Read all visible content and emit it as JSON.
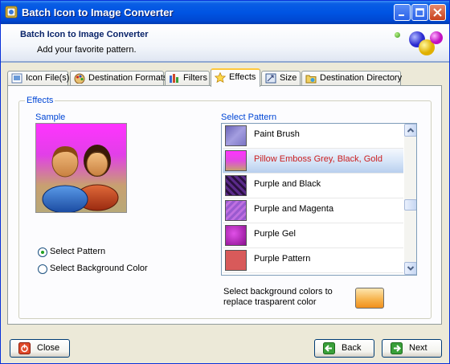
{
  "window": {
    "title": "Batch Icon to Image Converter",
    "controls": [
      "minimize-icon",
      "maximize-icon",
      "close-icon"
    ]
  },
  "header": {
    "title": "Batch Icon to Image Converter",
    "subtitle": "Add your favorite pattern."
  },
  "tabs": [
    {
      "label": "Icon File(s)",
      "icon": "icon-file-icon"
    },
    {
      "label": "Destination Formats",
      "icon": "palette-icon"
    },
    {
      "label": "Filters",
      "icon": "filter-icon"
    },
    {
      "label": "Effects",
      "icon": "star-icon",
      "active": true
    },
    {
      "label": "Size",
      "icon": "size-icon"
    },
    {
      "label": "Destination Directory",
      "icon": "folder-icon"
    }
  ],
  "effects": {
    "group_label": "Effects",
    "sample_label": "Sample",
    "select_pattern_label": "Select Pattern",
    "options": [
      {
        "label": "Select Pattern",
        "selected": true
      },
      {
        "label": "Select Background Color",
        "selected": false
      }
    ],
    "patterns": [
      {
        "name": "Paint Brush",
        "swatch": [
          "#7b74c4",
          "#9b95d8"
        ],
        "selected": false
      },
      {
        "name": "Pillow Emboss Grey, Black, Gold",
        "swatch": [
          "#ff33ff",
          "#c8a070"
        ],
        "selected": true
      },
      {
        "name": "Purple and Black",
        "swatch": [
          "#5a2a8a",
          "#2a1040"
        ],
        "selected": false
      },
      {
        "name": "Purple and Magenta",
        "swatch": [
          "#9a5ad0",
          "#c070e0"
        ],
        "selected": false
      },
      {
        "name": "Purple Gel",
        "swatch": [
          "#c020c8",
          "#8a108e"
        ],
        "selected": false
      },
      {
        "name": "Purple Pattern",
        "swatch": [
          "#d85a5a",
          "#c84848"
        ],
        "selected": false
      }
    ],
    "bg_note": "Select background colors to replace trasparent color",
    "bg_color": "#f7a838"
  },
  "footer": {
    "close_label": "Close",
    "back_label": "Back",
    "next_label": "Next"
  }
}
